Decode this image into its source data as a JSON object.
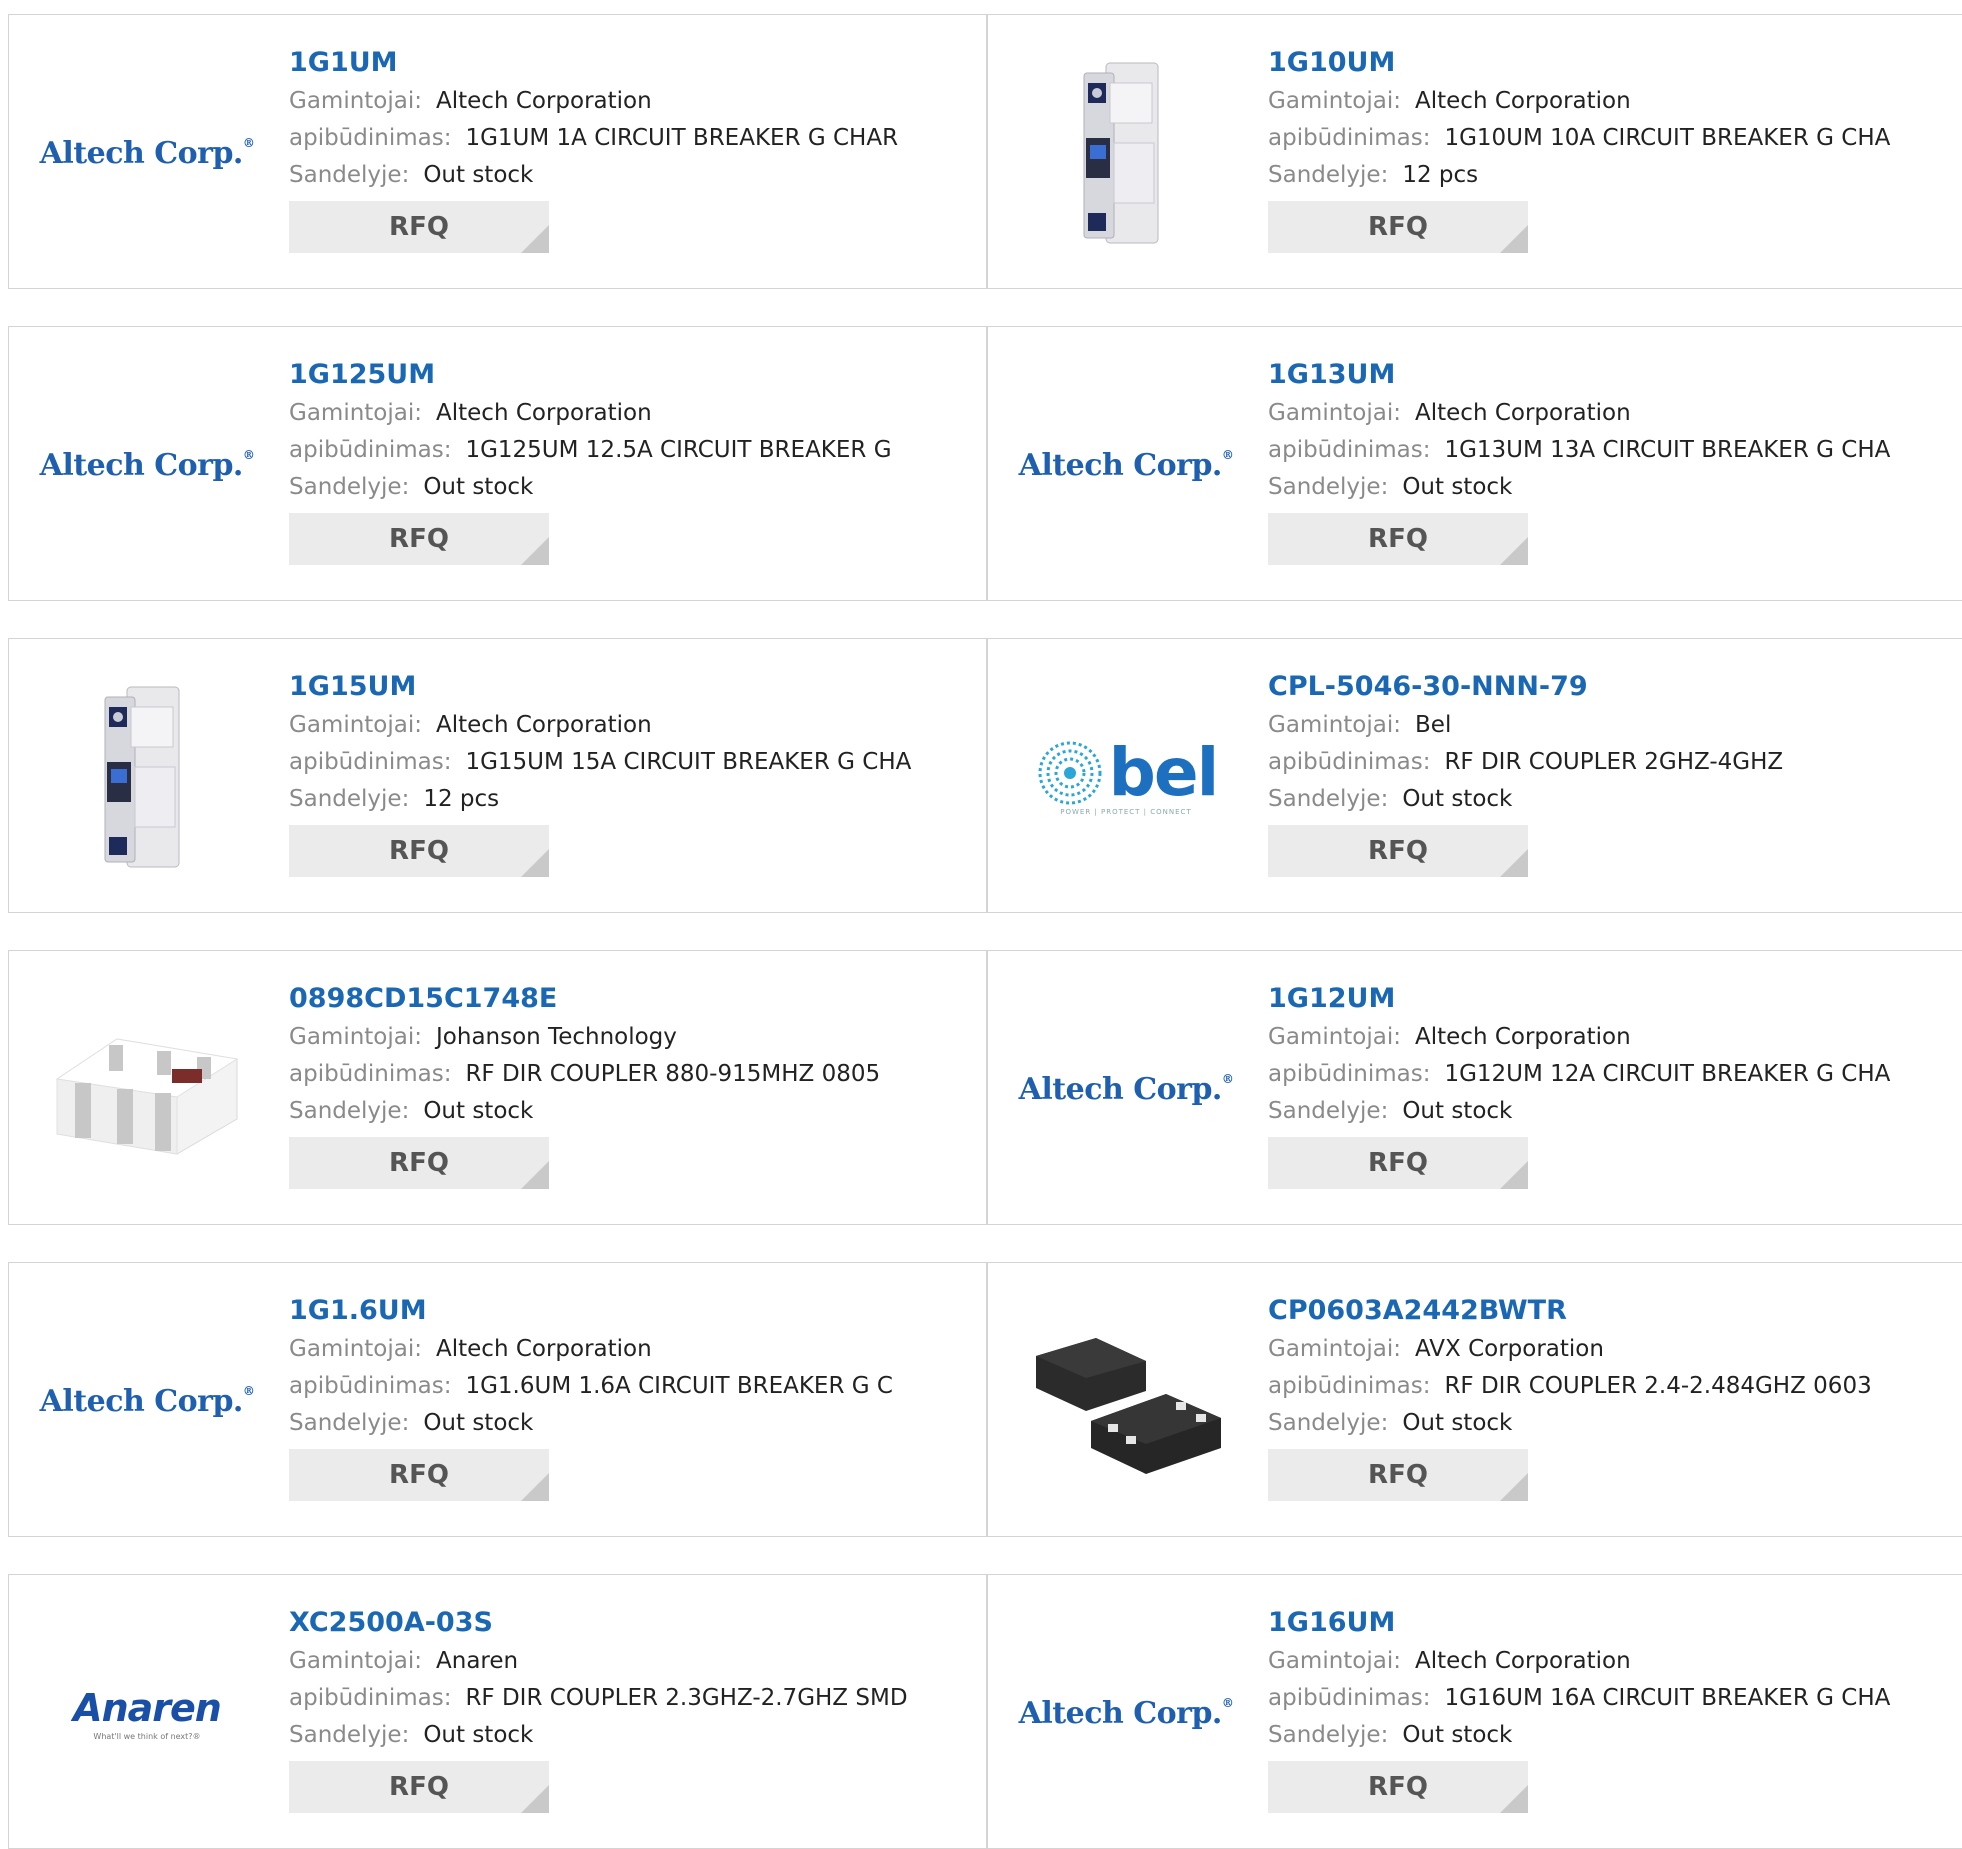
{
  "labels": {
    "manufacturer": "Gamintojai:",
    "description": "apibūdinimas:",
    "stock": "Sandelyje:",
    "rfq": "RFQ"
  },
  "logos": {
    "altech": "Altech Corp.",
    "altech_reg": "®",
    "anaren": "Anaren",
    "anaren_tag": "What'll we think of next?®",
    "bel": "bel",
    "bel_tag": "POWER | PROTECT | CONNECT"
  },
  "products": [
    {
      "part": "1G1UM",
      "manufacturer": "Altech Corporation",
      "description": "1G1UM 1A CIRCUIT BREAKER G CHAR",
      "stock": "Out stock",
      "image": "altech-logo"
    },
    {
      "part": "1G10UM",
      "manufacturer": "Altech Corporation",
      "description": "1G10UM 10A CIRCUIT BREAKER G CHA",
      "stock": "12 pcs",
      "image": "circuit-breaker-photo"
    },
    {
      "part": "1G125UM",
      "manufacturer": "Altech Corporation",
      "description": "1G125UM 12.5A CIRCUIT BREAKER G",
      "stock": "Out stock",
      "image": "altech-logo"
    },
    {
      "part": "1G13UM",
      "manufacturer": "Altech Corporation",
      "description": "1G13UM 13A CIRCUIT BREAKER G CHA",
      "stock": "Out stock",
      "image": "altech-logo"
    },
    {
      "part": "1G15UM",
      "manufacturer": "Altech Corporation",
      "description": "1G15UM 15A CIRCUIT BREAKER G CHA",
      "stock": "12 pcs",
      "image": "circuit-breaker-photo"
    },
    {
      "part": "CPL-5046-30-NNN-79",
      "manufacturer": "Bel",
      "description": "RF DIR COUPLER 2GHZ-4GHZ",
      "stock": "Out stock",
      "image": "bel-logo"
    },
    {
      "part": "0898CD15C1748E",
      "manufacturer": "Johanson Technology",
      "description": "RF DIR COUPLER 880-915MHZ 0805",
      "stock": "Out stock",
      "image": "chip-component-photo"
    },
    {
      "part": "1G12UM",
      "manufacturer": "Altech Corporation",
      "description": "1G12UM 12A CIRCUIT BREAKER G CHA",
      "stock": "Out stock",
      "image": "altech-logo"
    },
    {
      "part": "1G1.6UM",
      "manufacturer": "Altech Corporation",
      "description": "1G1.6UM 1.6A CIRCUIT BREAKER G C",
      "stock": "Out stock",
      "image": "altech-logo"
    },
    {
      "part": "CP0603A2442BWTR",
      "manufacturer": "AVX Corporation",
      "description": "RF DIR COUPLER 2.4-2.484GHZ 0603",
      "stock": "Out stock",
      "image": "smd-package-photo"
    },
    {
      "part": "XC2500A-03S",
      "manufacturer": "Anaren",
      "description": "RF DIR COUPLER 2.3GHZ-2.7GHZ SMD",
      "stock": "Out stock",
      "image": "anaren-logo"
    },
    {
      "part": "1G16UM",
      "manufacturer": "Altech Corporation",
      "description": "1G16UM 16A CIRCUIT BREAKER G CHA",
      "stock": "Out stock",
      "image": "altech-logo"
    }
  ],
  "colors": {
    "link": "#1a68b4",
    "label": "#8a8a8a",
    "button_bg": "#ebebeb",
    "border": "#d4d4d4"
  }
}
